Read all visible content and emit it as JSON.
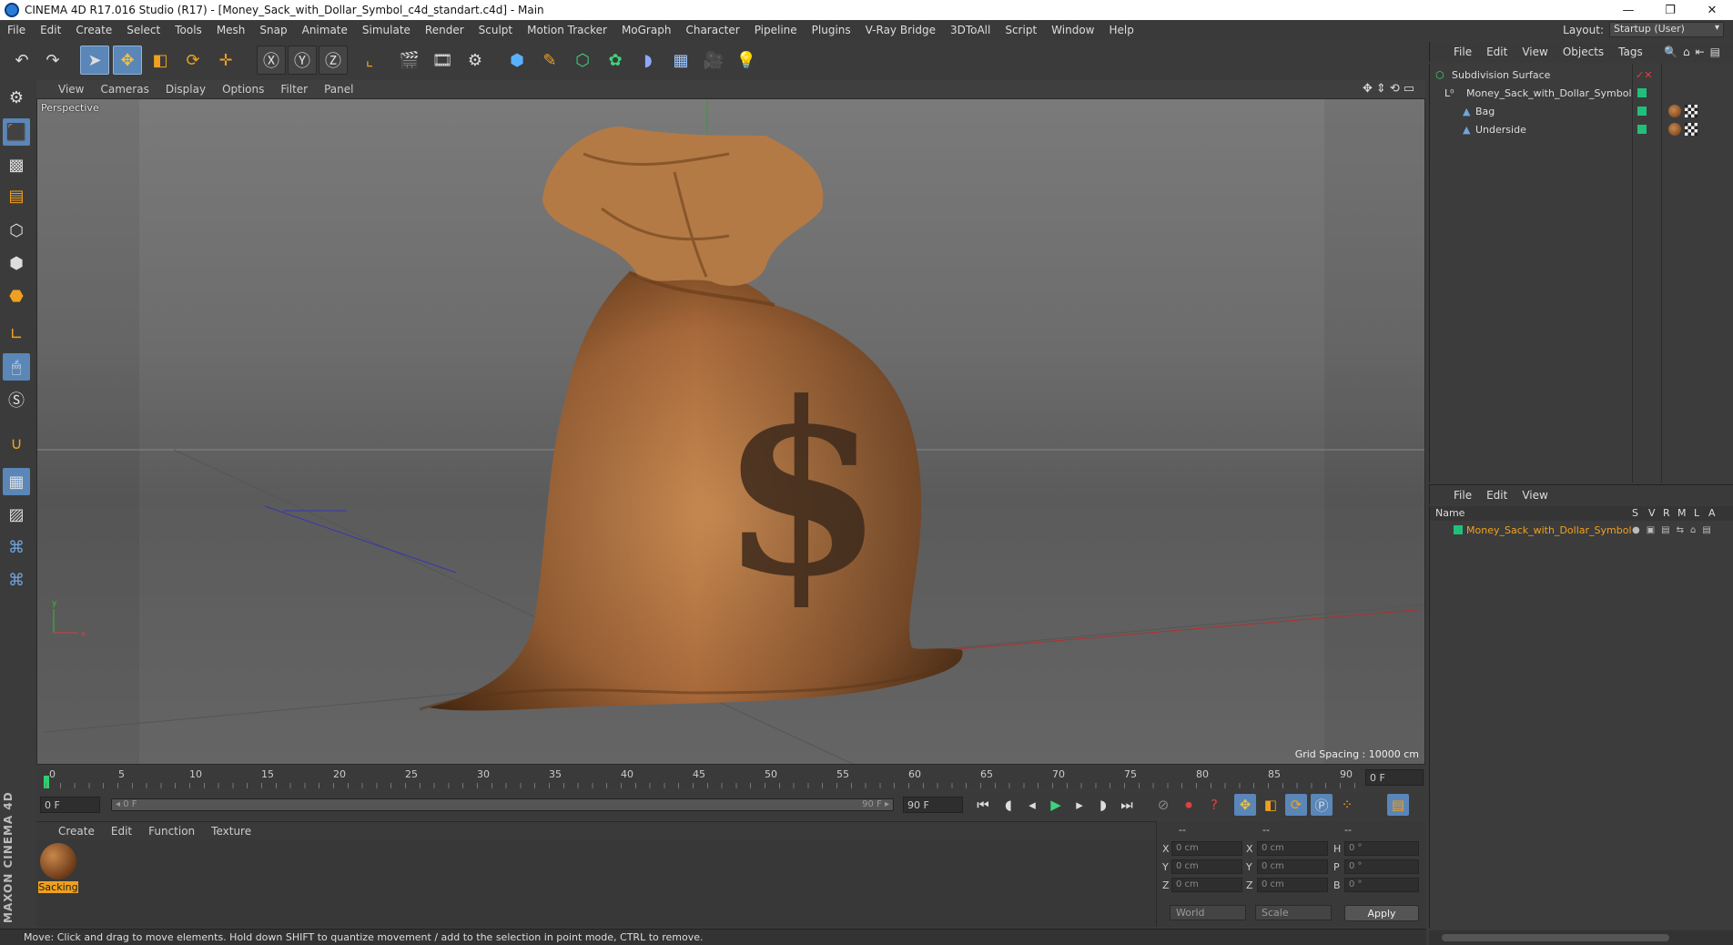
{
  "window": {
    "title": "CINEMA 4D R17.016 Studio (R17) - [Money_Sack_with_Dollar_Symbol_c4d_standart.c4d] - Main",
    "min": "—",
    "restore": "❐",
    "close": "✕"
  },
  "menu": [
    "File",
    "Edit",
    "Create",
    "Select",
    "Tools",
    "Mesh",
    "Snap",
    "Animate",
    "Simulate",
    "Render",
    "Sculpt",
    "Motion Tracker",
    "MoGraph",
    "Character",
    "Pipeline",
    "Plugins",
    "V-Ray Bridge",
    "3DToAll",
    "Script",
    "Window",
    "Help"
  ],
  "layout": {
    "label": "Layout:",
    "value": "Startup (User)"
  },
  "toolbar_icons": [
    "undo-icon",
    "redo-icon",
    "select-pointer-icon",
    "move-icon",
    "scale-icon",
    "rotate-icon",
    "transform-icon",
    "x-axis-icon",
    "y-axis-icon",
    "z-axis-icon",
    "world-coordinates-icon",
    "render-view-icon",
    "render-picture-viewer-icon",
    "edit-render-settings-icon",
    "cube-primitive-icon",
    "spline-pen-icon",
    "subdivision-icon",
    "array-icon",
    "deformer-icon",
    "floor-icon",
    "camera-icon",
    "light-icon"
  ],
  "viewport": {
    "menu": [
      "View",
      "Cameras",
      "Display",
      "Options",
      "Filter",
      "Panel"
    ],
    "label": "Perspective",
    "grid_spacing": "Grid Spacing : 10000 cm",
    "axis": {
      "x": "x",
      "y": "y"
    },
    "symbol": "$"
  },
  "timeline": {
    "ticks": [
      "0",
      "5",
      "10",
      "15",
      "20",
      "25",
      "30",
      "35",
      "40",
      "45",
      "50",
      "55",
      "60",
      "65",
      "70",
      "75",
      "80",
      "85",
      "90"
    ],
    "current_frame": "0 F",
    "start_field": "0 F",
    "range_start": "◂ 0 F",
    "range_end": "90 F ▸",
    "end_field": "90 F"
  },
  "material_manager": {
    "menu": [
      "Create",
      "Edit",
      "Function",
      "Texture"
    ],
    "material_name": "Sacking"
  },
  "brand": "MAXON CINEMA 4D",
  "coordinates": {
    "headers": [
      "--",
      "--",
      "--"
    ],
    "rows": [
      {
        "a": "X",
        "av": "0 cm",
        "b": "X",
        "bv": "0 cm",
        "c": "H",
        "cv": "0 °"
      },
      {
        "a": "Y",
        "av": "0 cm",
        "b": "Y",
        "bv": "0 cm",
        "c": "P",
        "cv": "0 °"
      },
      {
        "a": "Z",
        "av": "0 cm",
        "b": "Z",
        "bv": "0 cm",
        "c": "B",
        "cv": "0 °"
      }
    ],
    "mode1": "World",
    "mode2": "Scale",
    "apply": "Apply"
  },
  "status": "Move: Click and drag to move elements. Hold down SHIFT to quantize movement / add to the selection in point mode, CTRL to remove.",
  "object_manager": {
    "menu": [
      "File",
      "Edit",
      "View",
      "Objects",
      "Tags"
    ],
    "objects": [
      {
        "name": "Subdivision Surface"
      },
      {
        "name": "Money_Sack_with_Dollar_Symbol"
      },
      {
        "name": "Bag"
      },
      {
        "name": "Underside"
      }
    ]
  },
  "layer_manager": {
    "menu": [
      "File",
      "Edit",
      "View"
    ],
    "columns": {
      "name": "Name",
      "s": "S",
      "v": "V",
      "r": "R",
      "m": "M",
      "l": "L",
      "a": "A"
    },
    "layers": [
      {
        "name": "Money_Sack_with_Dollar_Symbol"
      }
    ]
  },
  "colors": {
    "accent": "#5a86b8",
    "layer_orange": "#f0a020",
    "status_green": "#21c07a"
  }
}
